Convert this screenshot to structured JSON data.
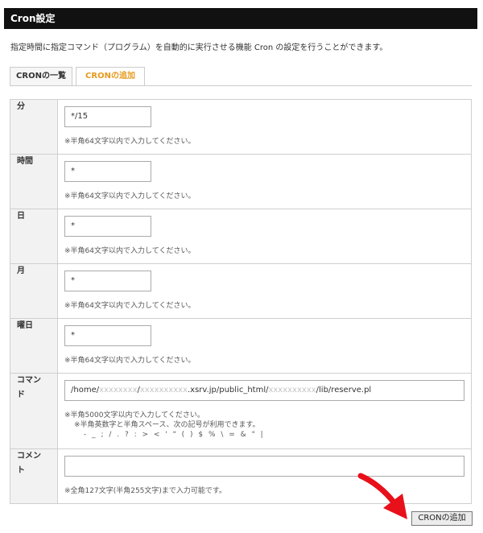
{
  "header": {
    "title": "Cron設定"
  },
  "description": "指定時間に指定コマンド（プログラム）を自動的に実行させる機能 Cron の設定を行うことができます。",
  "tabs": [
    {
      "label": "CRONの一覧",
      "active": false
    },
    {
      "label": "CRONの追加",
      "active": true
    }
  ],
  "form": {
    "minute": {
      "label": "分",
      "value": "*/15",
      "note": "※半角64文字以内で入力してください。"
    },
    "hour": {
      "label": "時間",
      "value": "*",
      "note": "※半角64文字以内で入力してください。"
    },
    "day": {
      "label": "日",
      "value": "*",
      "note": "※半角64文字以内で入力してください。"
    },
    "month": {
      "label": "月",
      "value": "*",
      "note": "※半角64文字以内で入力してください。"
    },
    "weekday": {
      "label": "曜日",
      "value": "*",
      "note": "※半角64文字以内で入力してください。"
    },
    "command": {
      "label_line1": "コマン",
      "label_line2": "ド",
      "value_parts": {
        "p1": "/home/",
        "b1": "xxxxxxxx",
        "p2": "/",
        "b2": "xxxxxxxxxx",
        "p3": ".xsrv.jp/public_html/",
        "b3": "xxxxxxxxxx",
        "p4": "/lib/reserve.pl"
      },
      "note_line1": "※半角5000文字以内で入力してください。",
      "note_line2": "※半角英数字と半角スペース、次の記号が利用できます。",
      "note_line3": "- _ ; / . ? : > < ' \" ( ) $ % \\ = & \" |"
    },
    "comment": {
      "label_line1": "コメン",
      "label_line2": "ト",
      "value": "",
      "note": "※全角127文字(半角255文字)まで入力可能です。"
    }
  },
  "submit": {
    "label": "CRONの追加"
  },
  "colors": {
    "header_bg": "#111111",
    "active_tab": "#e69a1e",
    "arrow": "#e8101a"
  }
}
